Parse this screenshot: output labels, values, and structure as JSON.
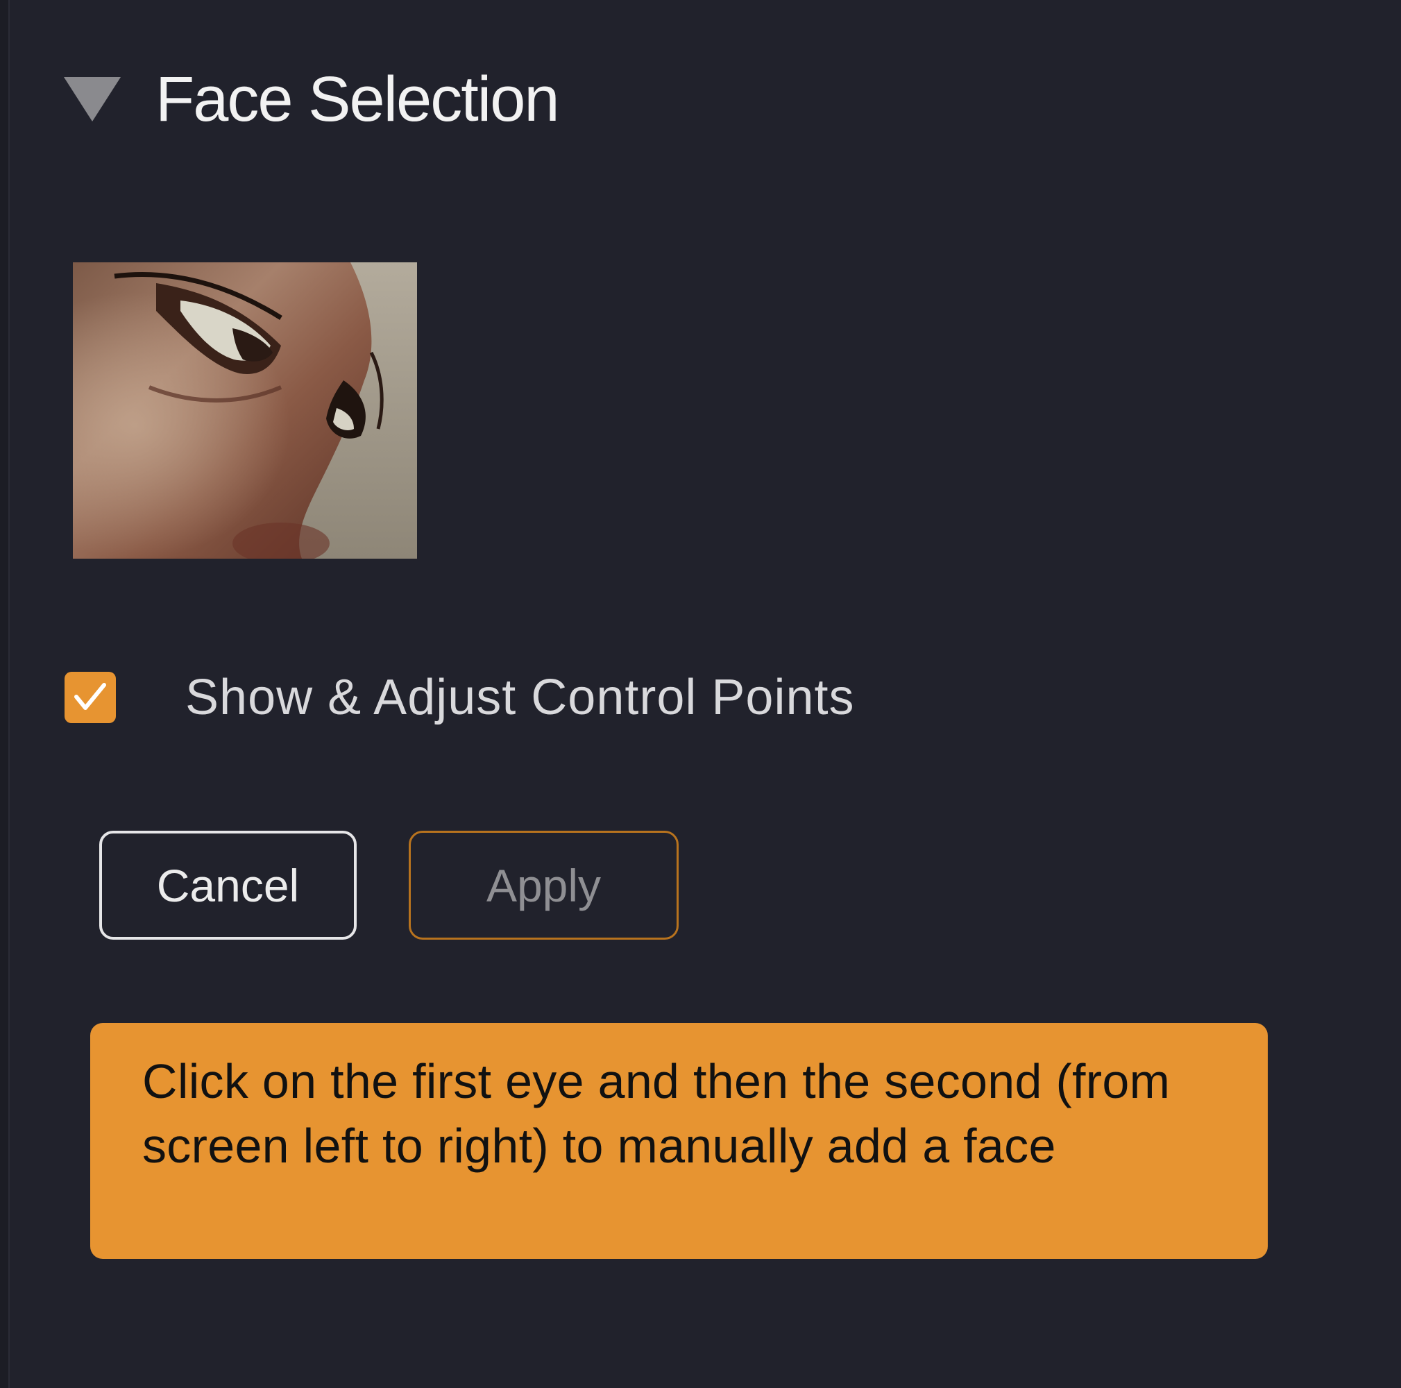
{
  "panel": {
    "title": "Face Selection",
    "expanded": true,
    "disclosure_icon": "triangle-down-icon"
  },
  "thumbnail": {
    "description_icon": "face-thumbnail",
    "selected": true
  },
  "control_points": {
    "label": "Show & Adjust Control Points",
    "checked": true,
    "check_icon": "checkmark-icon"
  },
  "buttons": {
    "cancel_label": "Cancel",
    "apply_label": "Apply",
    "apply_enabled": false
  },
  "hint": {
    "text": "Click on the first eye and then the second (from screen left to right) to manually add a face"
  },
  "colors": {
    "background": "#21222c",
    "accent": "#e79431",
    "apply_border": "#b8731e",
    "hint_text": "#111111"
  }
}
